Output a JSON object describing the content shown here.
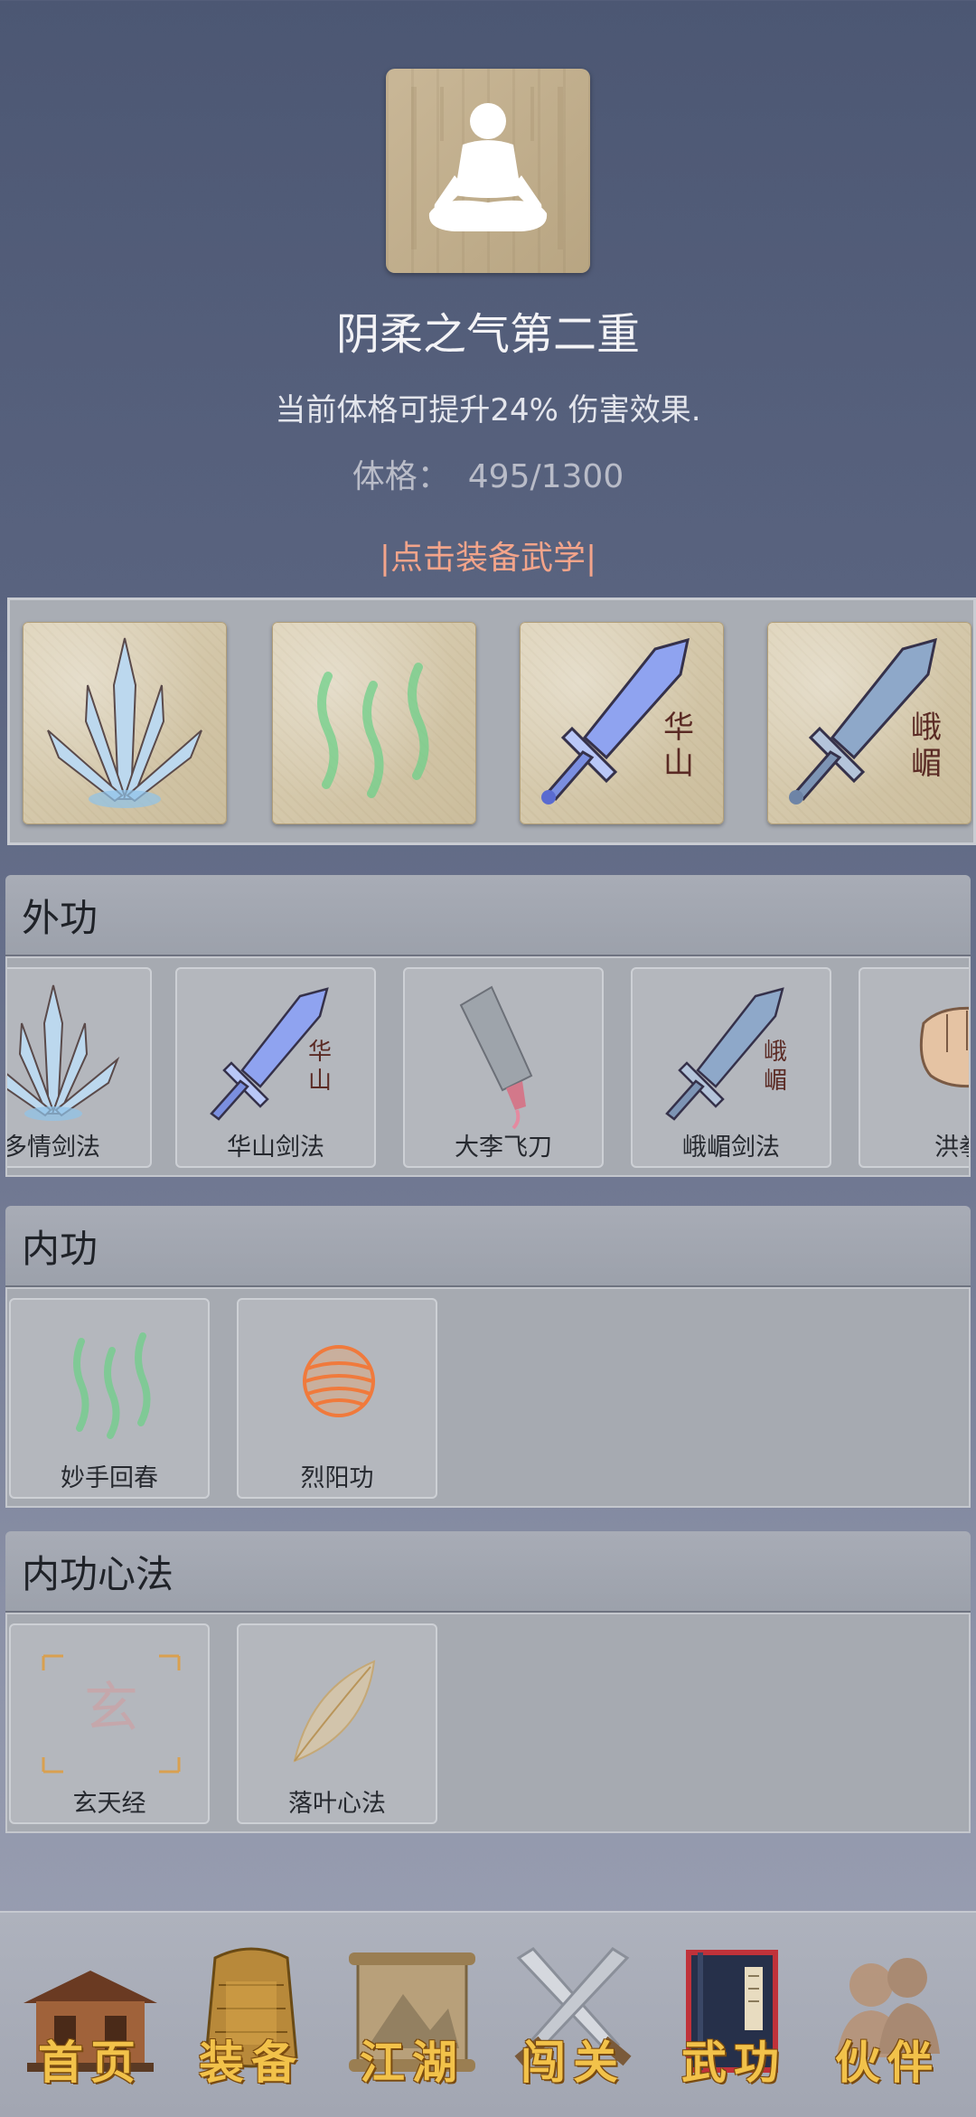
{
  "hero": {
    "portrait_icon": "meditation-figure-icon",
    "title": "阴柔之气第二重",
    "description": "当前体格可提升24% 伤害效果.",
    "stat_label": "体格：",
    "stat_value": "495/1300",
    "equip_link": "|点击装备武学|"
  },
  "equipped": [
    {
      "icon": "crystal-blades-icon"
    },
    {
      "icon": "green-wisps-icon"
    },
    {
      "icon": "huashan-sword-icon",
      "glyph": "华山"
    },
    {
      "icon": "emei-sword-icon",
      "glyph": "峨嵋"
    }
  ],
  "sections": {
    "external": {
      "title": "外功",
      "items": [
        {
          "label": "多情剑法",
          "icon": "crystal-blades-icon"
        },
        {
          "label": "华山剑法",
          "icon": "huashan-sword-icon",
          "glyph": "华山"
        },
        {
          "label": "大李飞刀",
          "icon": "cleaver-icon"
        },
        {
          "label": "峨嵋剑法",
          "icon": "emei-sword-icon",
          "glyph": "峨嵋"
        },
        {
          "label": "洪拳",
          "icon": "fist-icon"
        }
      ]
    },
    "internal": {
      "title": "内功",
      "items": [
        {
          "label": "妙手回春",
          "icon": "green-wisps-icon"
        },
        {
          "label": "烈阳功",
          "icon": "fire-orb-icon"
        }
      ]
    },
    "mind": {
      "title": "内功心法",
      "items": [
        {
          "label": "玄天经",
          "icon": "xuan-rune-icon",
          "glyph": "玄"
        },
        {
          "label": "落叶心法",
          "icon": "leaf-icon"
        }
      ]
    }
  },
  "nav": [
    {
      "label": "首页",
      "icon": "pavilion-icon"
    },
    {
      "label": "装备",
      "icon": "armor-icon"
    },
    {
      "label": "江湖",
      "icon": "scroll-map-icon"
    },
    {
      "label": "闯关",
      "icon": "crossed-swords-icon"
    },
    {
      "label": "武功",
      "icon": "martial-book-icon",
      "active": true
    },
    {
      "label": "伙伴",
      "icon": "companions-icon"
    }
  ],
  "colors": {
    "link": "#f3a48a",
    "nav_label": "#f2c24a",
    "active_book": "#c0323a"
  }
}
